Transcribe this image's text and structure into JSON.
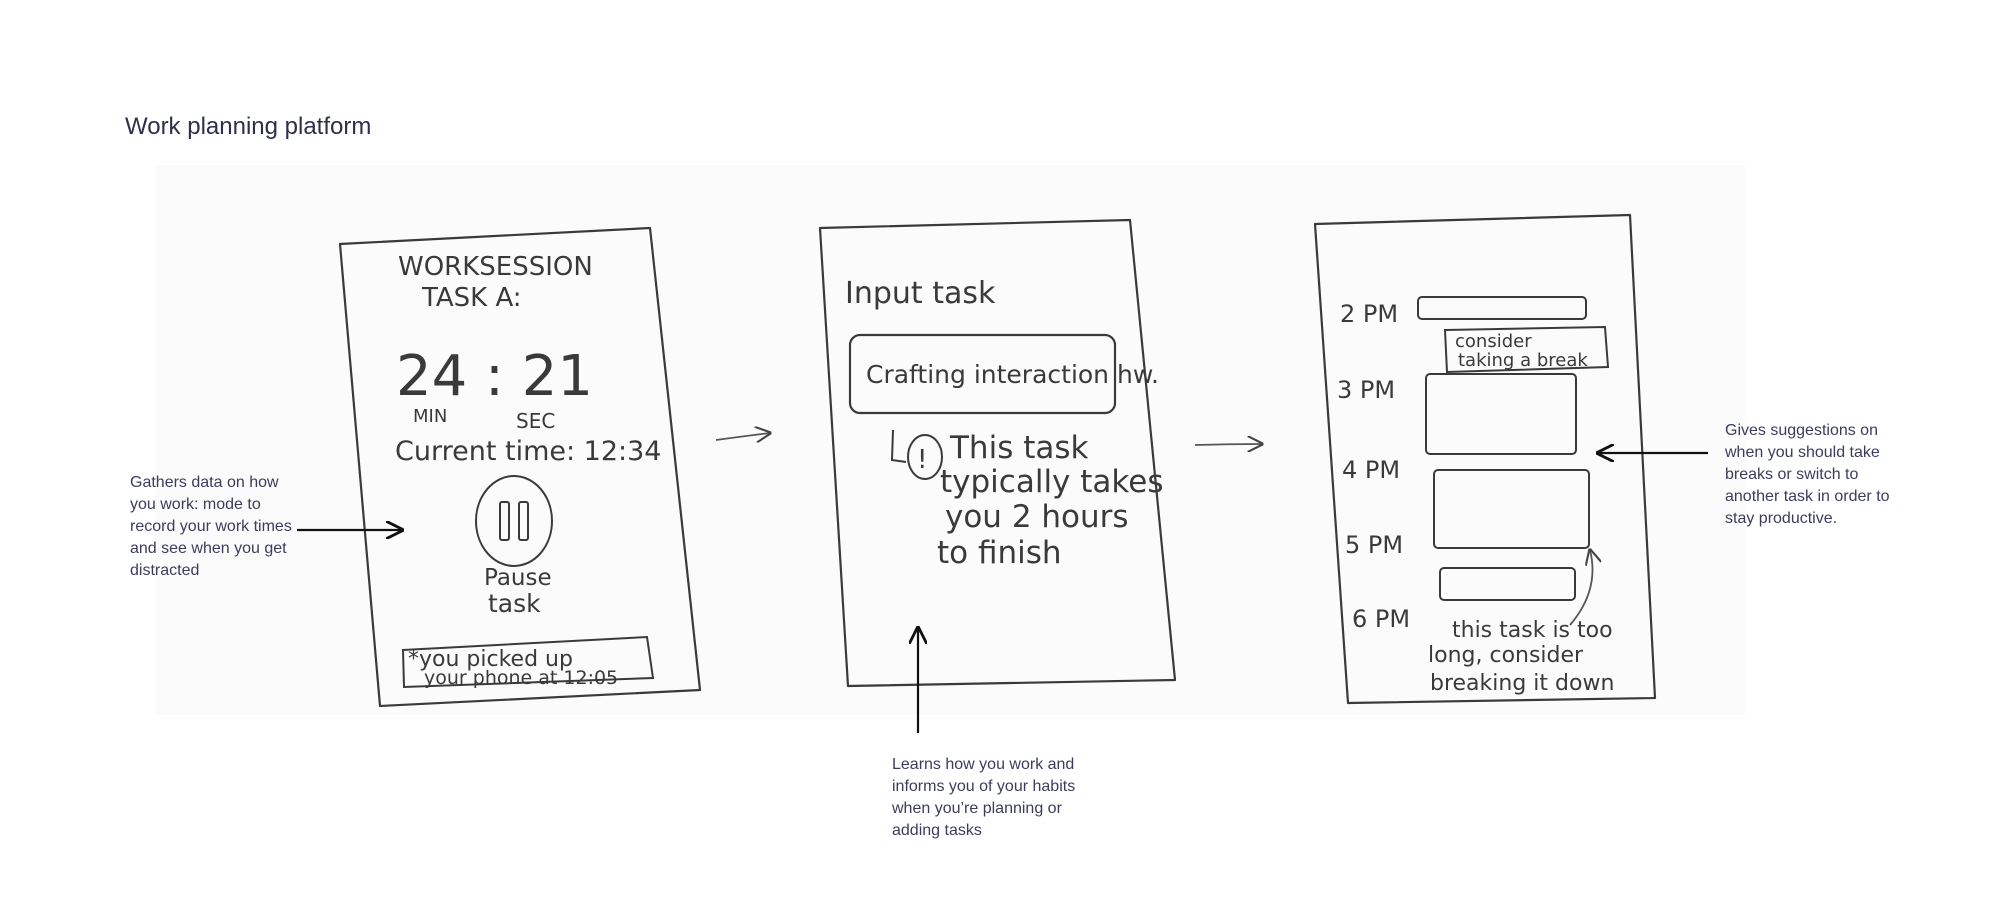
{
  "page_title": "Work planning platform",
  "annotations": {
    "left": "Gathers data on how you work: mode to record your work times and see when you get distracted",
    "bottom": "Learns how you work and informs you of your habits when you’re planning or adding tasks",
    "right": "Gives suggestions on when you should take breaks or switch to another task in order to stay productive."
  },
  "screen1": {
    "heading_line1": "WORKSESSION",
    "heading_line2": "TASK A:",
    "timer": "24 : 21",
    "min_label": "MIN",
    "sec_label": "SEC",
    "current_time": "Current time: 12:34",
    "pause_line1": "Pause",
    "pause_line2": "task",
    "alert_line1": "*you picked up",
    "alert_line2": "your phone at 12:05"
  },
  "screen2": {
    "heading": "Input task",
    "input_value": "Crafting interaction hw.",
    "tip_line1": "This task",
    "tip_line2": "typically takes",
    "tip_line3": "you 2 hours",
    "tip_line4": "to finish",
    "tip_icon": "!"
  },
  "screen3": {
    "times": [
      "2 PM",
      "3 PM",
      "4 PM",
      "5 PM",
      "6 PM"
    ],
    "break_line1": "consider",
    "break_line2": "taking a break",
    "note_line1": "this task is too",
    "note_line2": "long, consider",
    "note_line3": "breaking it down"
  },
  "colors": {
    "ink": "#3a3a3a",
    "annotation_text": "#3b3d5c",
    "title_text": "#2e2f4a",
    "arrow": "#111111"
  }
}
